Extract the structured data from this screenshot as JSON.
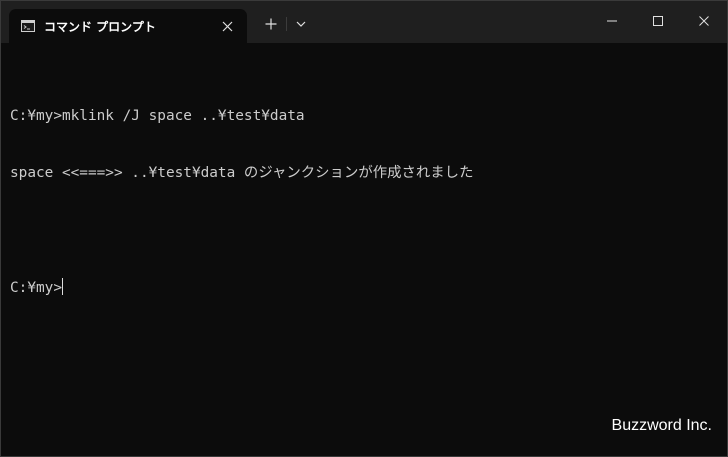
{
  "window": {
    "tab_title": "コマンド プロンプト",
    "tab_icon": "cmd-icon",
    "new_tab_label": "+",
    "close_tab_label": "✕"
  },
  "console": {
    "lines": [
      "C:¥my>mklink /J space ..¥test¥data",
      "space <<===>> ..¥test¥data のジャンクションが作成されました",
      "",
      "C:¥my>"
    ]
  },
  "watermark": "Buzzword Inc.",
  "colors": {
    "titlebar": "#1f1f1f",
    "console_bg": "#0c0c0c",
    "console_text": "#cccccc"
  }
}
